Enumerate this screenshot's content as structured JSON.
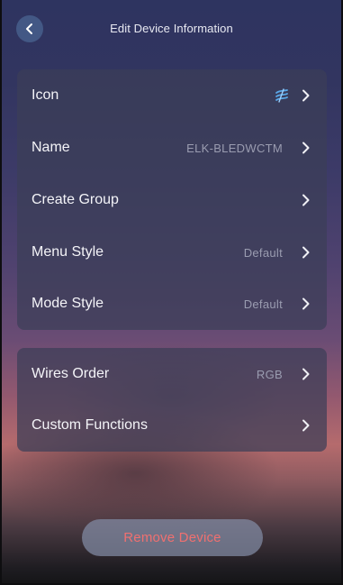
{
  "header": {
    "title": "Edit Device Information",
    "back_icon": "chevron-left-icon"
  },
  "settings_group_1": {
    "rows": [
      {
        "label": "Icon",
        "value": "",
        "icon": "device-strip-icon"
      },
      {
        "label": "Name",
        "value": "ELK-BLEDWCTM"
      },
      {
        "label": "Create Group",
        "value": ""
      },
      {
        "label": "Menu Style",
        "value": "Default"
      },
      {
        "label": "Mode Style",
        "value": "Default"
      }
    ]
  },
  "settings_group_2": {
    "rows": [
      {
        "label": "Wires Order",
        "value": "RGB"
      },
      {
        "label": "Custom Functions",
        "value": ""
      }
    ]
  },
  "footer": {
    "remove_label": "Remove Device"
  },
  "colors": {
    "accent_icon": "#5aa8e8",
    "danger_text": "#f07070",
    "card_bg": "#3c3e58"
  }
}
